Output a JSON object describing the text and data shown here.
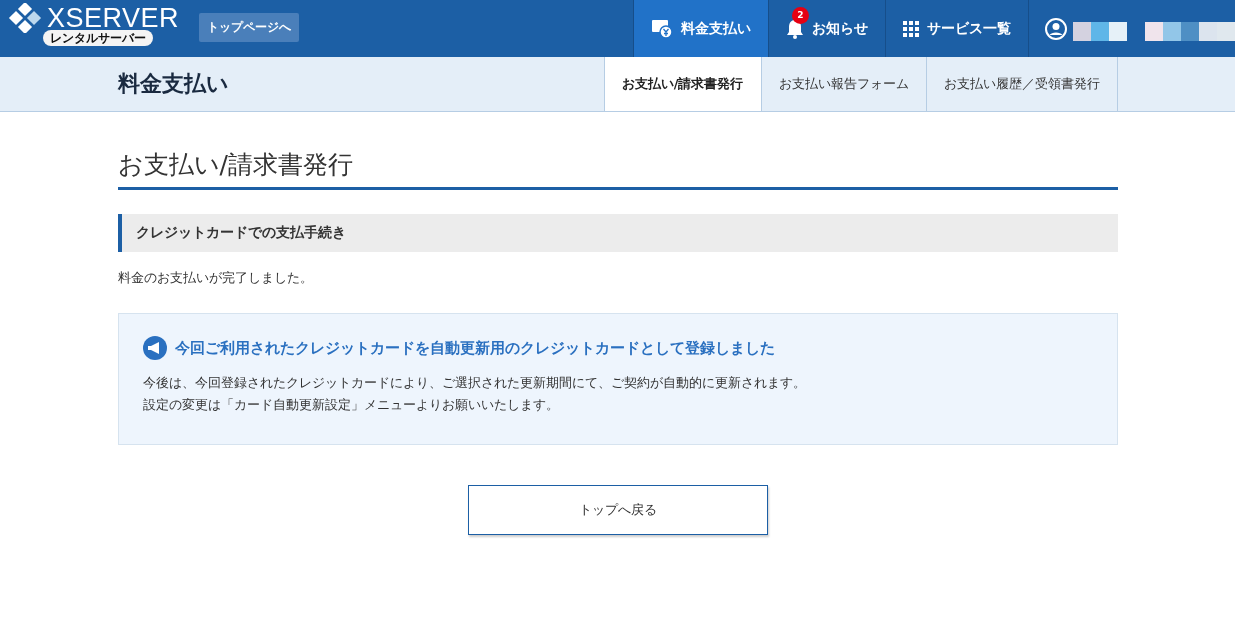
{
  "header": {
    "logo": {
      "name": "XSERVER",
      "sub": "レンタルサーバー"
    },
    "top_link": "トップページへ",
    "nav": [
      {
        "label": "料金支払い",
        "kind": "billing",
        "selected": true
      },
      {
        "label": "お知らせ",
        "kind": "notifications",
        "selected": false,
        "badge": "2"
      },
      {
        "label": "サービス一覧",
        "kind": "services",
        "selected": false
      }
    ]
  },
  "subheader": {
    "title": "料金支払い",
    "tabs": [
      {
        "label": "お支払い/請求書発行",
        "selected": true
      },
      {
        "label": "お支払い報告フォーム",
        "selected": false
      },
      {
        "label": "お支払い履歴／受領書発行",
        "selected": false
      }
    ]
  },
  "page_title": "お支払い/請求書発行",
  "section_title": "クレジットカードでの支払手続き",
  "message": "料金のお支払いが完了しました。",
  "notice": {
    "title": "今回ご利用されたクレジットカードを自動更新用のクレジットカードとして登録しました",
    "lines": [
      "今後は、今回登録されたクレジットカードにより、ご選択された更新期間にて、ご契約が自動的に更新されます。",
      "設定の変更は「カード自動更新設定」メニューよりお願いいたします。"
    ]
  },
  "back_button": "トップへ戻る"
}
